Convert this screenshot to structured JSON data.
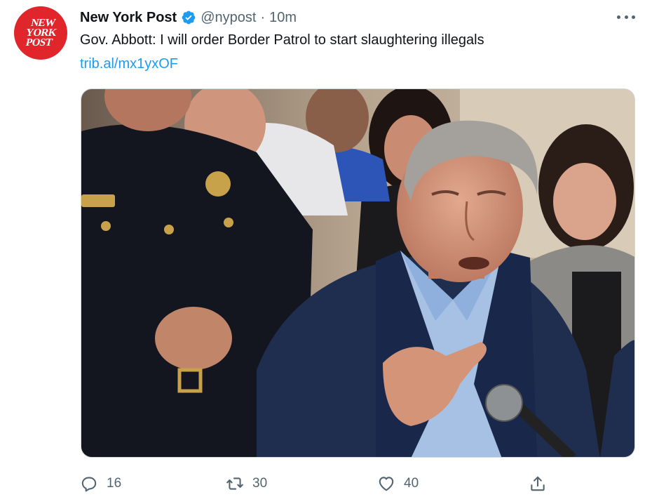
{
  "author": {
    "logo_lines": [
      "NEW",
      "YORK",
      "POST"
    ],
    "name": "New York Post",
    "handle": "@nypost",
    "separator": "·",
    "time": "10m",
    "brand_color": "#e0252b",
    "verified_color": "#1d9bf0"
  },
  "tweet": {
    "text": "Gov. Abbott: I will order Border Patrol to start slaughtering illegals",
    "link": "trib.al/mx1yxOF",
    "link_color": "#1d9bf0"
  },
  "media": {
    "kind": "photo",
    "description_icon": "photo"
  },
  "actions": {
    "reply_count": "16",
    "retweet_count": "30",
    "like_count": "40",
    "icons": [
      "reply-icon",
      "retweet-icon",
      "like-icon",
      "share-icon"
    ]
  }
}
